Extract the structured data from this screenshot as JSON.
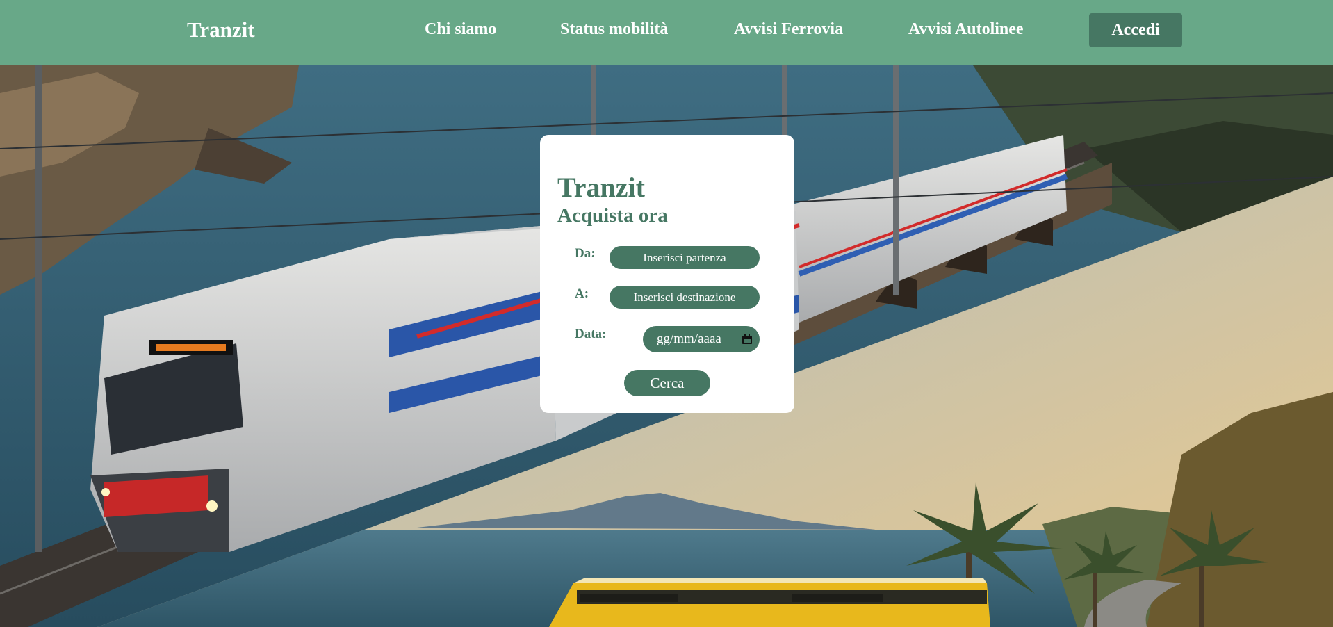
{
  "nav": {
    "brand": "Tranzit",
    "links": [
      "Chi siamo",
      "Status mobilità",
      "Avvisi Ferrovia",
      "Avvisi Autolinee"
    ],
    "login_label": "Accedi"
  },
  "booking": {
    "title": "Tranzit",
    "subtitle": "Acquista ora",
    "from_label": "Da:",
    "from_placeholder": "Inserisci partenza",
    "to_label": "A:",
    "to_placeholder": "Inserisci destinazione",
    "date_label": "Data:",
    "date_placeholder": "gg/mm/aaaa",
    "search_label": "Cerca"
  },
  "colors": {
    "nav_bg": "#68a888",
    "accent": "#467763",
    "card_bg": "#ffffff"
  },
  "icons": {
    "date": "calendar-icon"
  },
  "images": {
    "hero_top": "photo of a red-white-blue regional train on a coastal bridge",
    "hero_bottom": "photo of a yellow bus on a coastal road with palm trees and a volcano"
  }
}
